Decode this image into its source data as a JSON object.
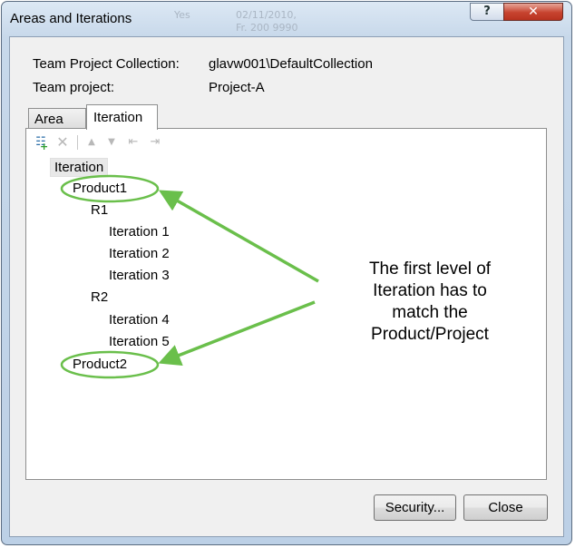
{
  "window": {
    "title": "Areas and Iterations",
    "help_label": "?",
    "close_label": "✕",
    "background_ghost_text": [
      "Yes",
      "02/11/2010,",
      "Fr. 200 9990"
    ]
  },
  "info": {
    "collection_label": "Team Project Collection:",
    "collection_value": "glavw001\\DefaultCollection",
    "project_label": "Team project:",
    "project_value": "Project-A"
  },
  "tabs": [
    {
      "label": "Area",
      "active": false
    },
    {
      "label": "Iteration",
      "active": true
    }
  ],
  "toolbar": {
    "icons": [
      "new-node-icon",
      "delete-icon",
      "move-up-icon",
      "move-down-icon",
      "indent-icon",
      "outdent-icon"
    ]
  },
  "tree": {
    "root": "Iteration",
    "nodes": [
      "Product1",
      "R1",
      "Iteration 1",
      "Iteration 2",
      "Iteration 3",
      "R2",
      "Iteration 4",
      "Iteration 5",
      "Product2"
    ]
  },
  "annotation": {
    "lines": [
      "The first level of",
      "Iteration has to",
      "match the",
      "Product/Project"
    ],
    "color": "#6abf4b"
  },
  "buttons": {
    "security": "Security...",
    "close": "Close"
  },
  "colors": {
    "title_bar": "#c7d8ea",
    "close_button": "#c7432f",
    "highlight_green": "#6abf4b"
  }
}
